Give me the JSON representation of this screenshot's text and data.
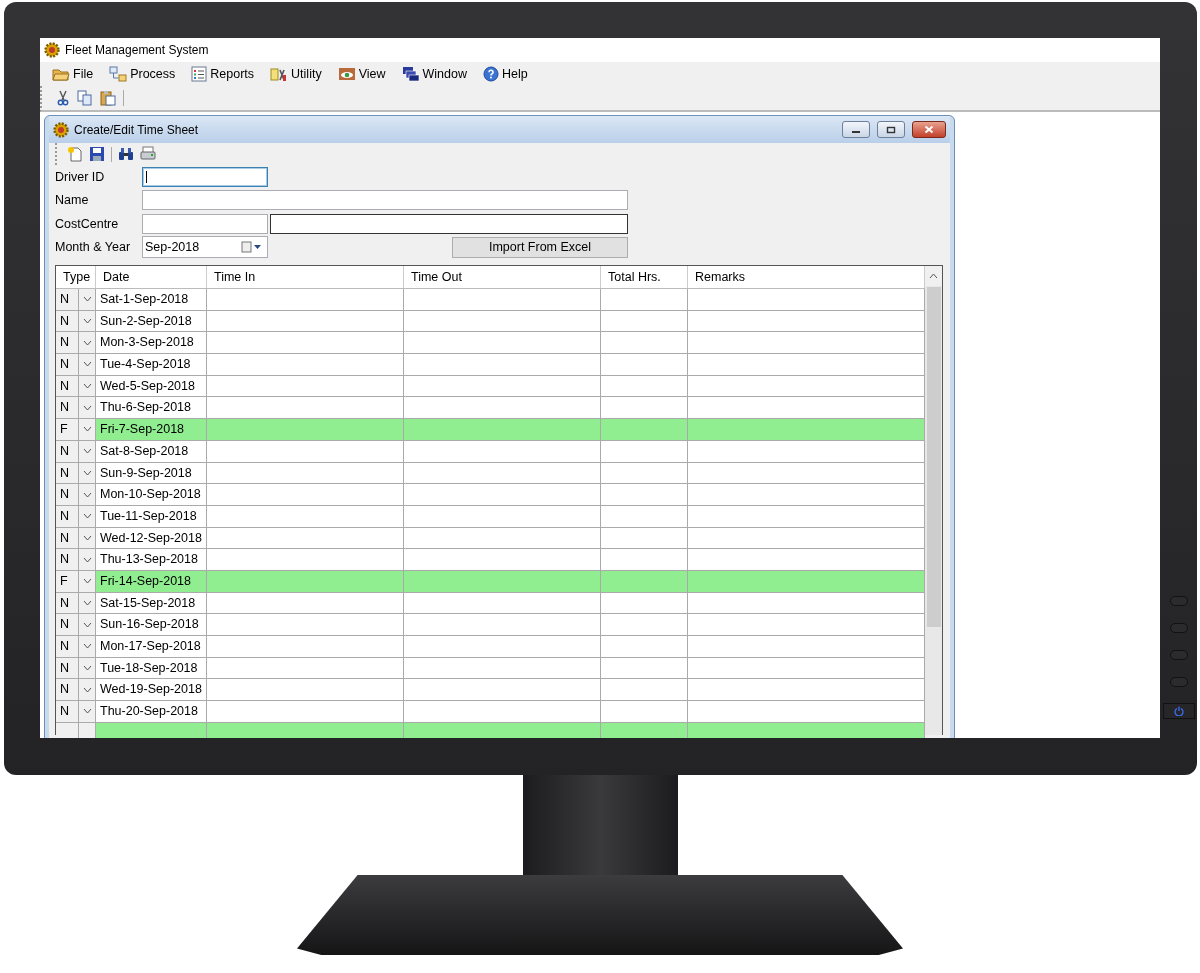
{
  "window": {
    "title": "Fleet Management System"
  },
  "menu": [
    "File",
    "Process",
    "Reports",
    "Utility",
    "View",
    "Window",
    "Help"
  ],
  "child_window": {
    "title": "Create/Edit Time Sheet",
    "fields": [
      {
        "label": "Driver ID",
        "kind": "short",
        "focused": true
      },
      {
        "label": "Name",
        "kind": "wide",
        "focused": false
      },
      {
        "label": "CostCentre",
        "kind": "pair",
        "focused": false
      },
      {
        "label": "Month & Year",
        "kind": "date",
        "value": "Sep-2018",
        "focused": false
      }
    ],
    "import_button": "Import From Excel",
    "grid": {
      "columns": [
        "Type",
        "Date",
        "Time In",
        "Time Out",
        "Total Hrs.",
        "Remarks"
      ],
      "rows": [
        {
          "type": "N",
          "date": "Sat-1-Sep-2018",
          "highlighted": false
        },
        {
          "type": "N",
          "date": "Sun-2-Sep-2018",
          "highlighted": false
        },
        {
          "type": "N",
          "date": "Mon-3-Sep-2018",
          "highlighted": false
        },
        {
          "type": "N",
          "date": "Tue-4-Sep-2018",
          "highlighted": false
        },
        {
          "type": "N",
          "date": "Wed-5-Sep-2018",
          "highlighted": false
        },
        {
          "type": "N",
          "date": "Thu-6-Sep-2018",
          "highlighted": false
        },
        {
          "type": "F",
          "date": "Fri-7-Sep-2018",
          "highlighted": true
        },
        {
          "type": "N",
          "date": "Sat-8-Sep-2018",
          "highlighted": false
        },
        {
          "type": "N",
          "date": "Sun-9-Sep-2018",
          "highlighted": false
        },
        {
          "type": "N",
          "date": "Mon-10-Sep-2018",
          "highlighted": false
        },
        {
          "type": "N",
          "date": "Tue-11-Sep-2018",
          "highlighted": false
        },
        {
          "type": "N",
          "date": "Wed-12-Sep-2018",
          "highlighted": false
        },
        {
          "type": "N",
          "date": "Thu-13-Sep-2018",
          "highlighted": false
        },
        {
          "type": "F",
          "date": "Fri-14-Sep-2018",
          "highlighted": true
        },
        {
          "type": "N",
          "date": "Sat-15-Sep-2018",
          "highlighted": false
        },
        {
          "type": "N",
          "date": "Sun-16-Sep-2018",
          "highlighted": false
        },
        {
          "type": "N",
          "date": "Mon-17-Sep-2018",
          "highlighted": false
        },
        {
          "type": "N",
          "date": "Tue-18-Sep-2018",
          "highlighted": false
        },
        {
          "type": "N",
          "date": "Wed-19-Sep-2018",
          "highlighted": false
        },
        {
          "type": "N",
          "date": "Thu-20-Sep-2018",
          "highlighted": false
        }
      ],
      "cut_row": {
        "highlighted": true
      }
    }
  }
}
